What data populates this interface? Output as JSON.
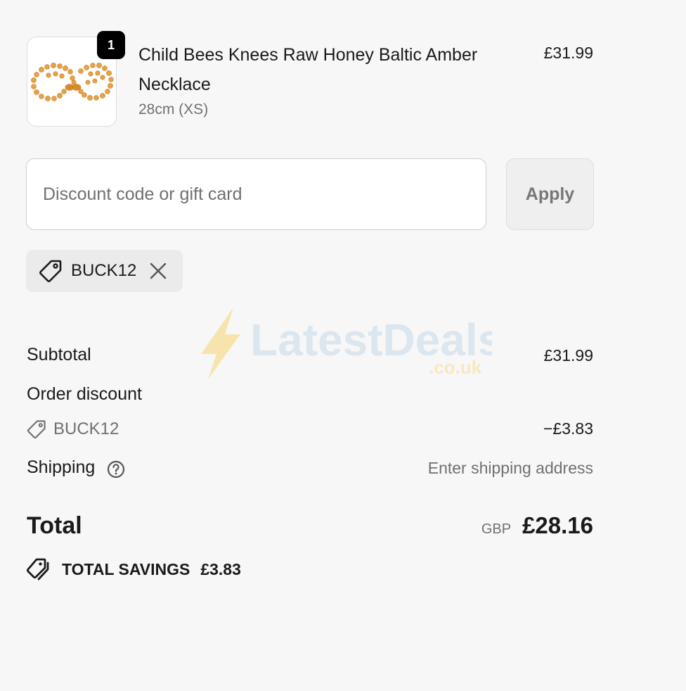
{
  "line_item": {
    "quantity": "1",
    "title": "Child Bees Knees Raw Honey Baltic Amber Necklace",
    "variant": "28cm (XS)",
    "price": "£31.99",
    "image_icon": "amber-necklace-image"
  },
  "discount": {
    "placeholder": "Discount code or gift card",
    "value": "",
    "apply_label": "Apply",
    "applied_code": "BUCK12"
  },
  "watermark": {
    "brand": "LatestDeals",
    "suffix": ".co.uk"
  },
  "summary": {
    "subtotal_label": "Subtotal",
    "subtotal_value": "£31.99",
    "order_discount_label": "Order discount",
    "discount_code": "BUCK12",
    "discount_value": "−£3.83",
    "shipping_label": "Shipping",
    "shipping_value": "Enter shipping address",
    "total_label": "Total",
    "currency": "GBP",
    "total_value": "£28.16",
    "savings_label": "TOTAL SAVINGS",
    "savings_value": "£3.83"
  },
  "colors": {
    "background": "#f7f7f7",
    "text": "#1a1a1a",
    "muted": "#707070",
    "badge": "#000000",
    "amber": "#e8a33c"
  }
}
